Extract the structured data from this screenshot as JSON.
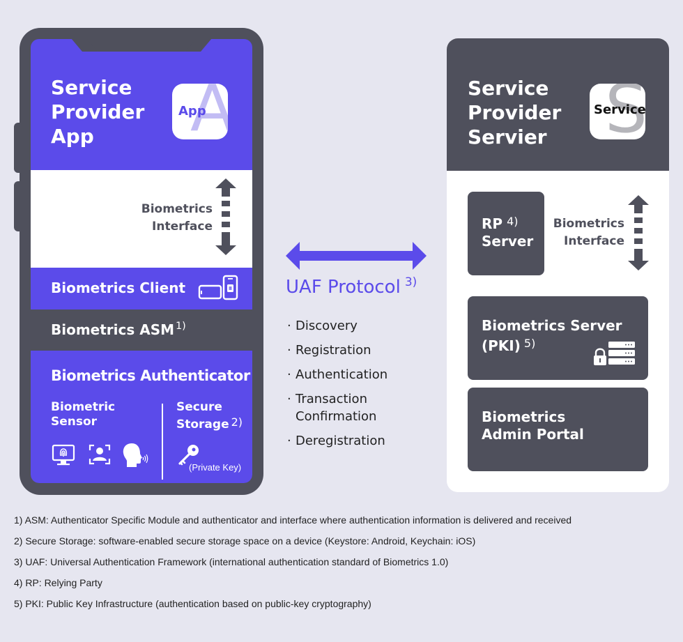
{
  "colors": {
    "background": "#e6e6f0",
    "accent_purple": "#5b4bea",
    "dark_gray": "#4f505c",
    "white": "#ffffff",
    "icon_letter_light_purple": "#c2bcf4",
    "icon_letter_gray": "#b5b5ba"
  },
  "client": {
    "title_lines": [
      "Service",
      "Provider",
      "App"
    ],
    "app_icon": {
      "big_letter": "A",
      "label": "App"
    },
    "interface_label_lines": [
      "Biometrics",
      "Interface"
    ],
    "biometrics_client": {
      "label": "Biometrics Client",
      "icon": "phone-rotate-icon"
    },
    "biometrics_asm": {
      "label": "Biometrics ASM",
      "footnote_ref": "1)"
    },
    "authenticator": {
      "title": "Biometrics Authenticator",
      "sensor_label_lines": [
        "Biometric",
        "Sensor"
      ],
      "sensor_icons": [
        "fingerprint-monitor-icon",
        "face-scan-icon",
        "voice-recognition-icon"
      ],
      "storage_label_lines": [
        "Secure",
        "Storage"
      ],
      "storage_footnote_ref": "2)",
      "key_icon": "key-icon",
      "key_caption": "(Private Key)"
    }
  },
  "protocol": {
    "title": "UAF Protocol",
    "footnote_ref": "3)",
    "arrow": "double-arrow",
    "items": [
      "Discovery",
      "Registration",
      "Authentication",
      "Transaction Confirmation",
      "Deregistration"
    ],
    "items_display": [
      [
        "Discovery"
      ],
      [
        "Registration"
      ],
      [
        "Authentication"
      ],
      [
        "Transaction",
        "Confirmation"
      ],
      [
        "Deregistration"
      ]
    ]
  },
  "server": {
    "title_lines": [
      "Service",
      "Provider",
      "Servier"
    ],
    "service_icon": {
      "big_letter": "S",
      "label": "Service"
    },
    "rp_server": {
      "label_lines": [
        "RP",
        "Server"
      ],
      "footnote_ref": "4)"
    },
    "interface_label_lines": [
      "Biometrics",
      "Interface"
    ],
    "biometrics_server": {
      "label_lines": [
        "Biometrics Server",
        "(PKI)"
      ],
      "footnote_ref": "5)",
      "icon": "secure-server-icon"
    },
    "admin_portal": {
      "label_lines": [
        "Biometrics",
        "Admin Portal"
      ]
    }
  },
  "footnotes": [
    "1) ASM: Authenticator Specific Module and authenticator and interface where authentication information is delivered and received",
    "2) Secure Storage: software-enabled secure storage space on a device (Keystore: Android, Keychain: iOS)",
    "3) UAF: Universal Authentication Framework (international authentication standard of Biometrics 1.0)",
    "4) RP: Relying Party",
    "5) PKI: Public Key Infrastructure (authentication based on public-key cryptography)"
  ]
}
